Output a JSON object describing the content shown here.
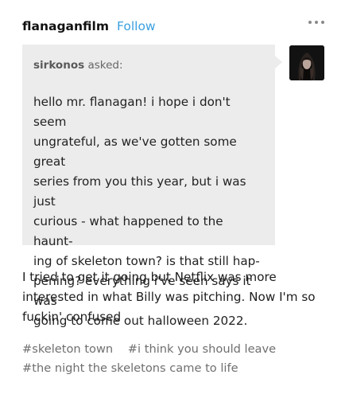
{
  "header": {
    "blog_name": "flanaganfilm",
    "follow_label": "Follow"
  },
  "ask": {
    "asker": "sirkonos",
    "asked_label": "asked:",
    "question_lines": [
      "hello mr. flanagan! i hope i don't seem",
      "ungrateful, as we've gotten some great",
      "series from you this year, but i was just",
      "curious - what happened to the haunt-",
      "ing of skeleton town? is that still hap-",
      "pening? everything i've seen says it was",
      "going to come out halloween 2022."
    ]
  },
  "answer": {
    "lines": [
      "I tried to get it going but Netflix was more",
      "interested in what Billy was pitching. Now I'm so",
      "fuckin' confused"
    ]
  },
  "tags": [
    "#skeleton town",
    "#i think you should leave",
    "#the night the skeletons came to life"
  ],
  "icons": {
    "more": "more-horizontal-icon",
    "avatar": "asker-avatar"
  },
  "colors": {
    "follow": "#3aa0e0",
    "ask_background": "#ececec",
    "tag_text": "#6f6f6f"
  }
}
